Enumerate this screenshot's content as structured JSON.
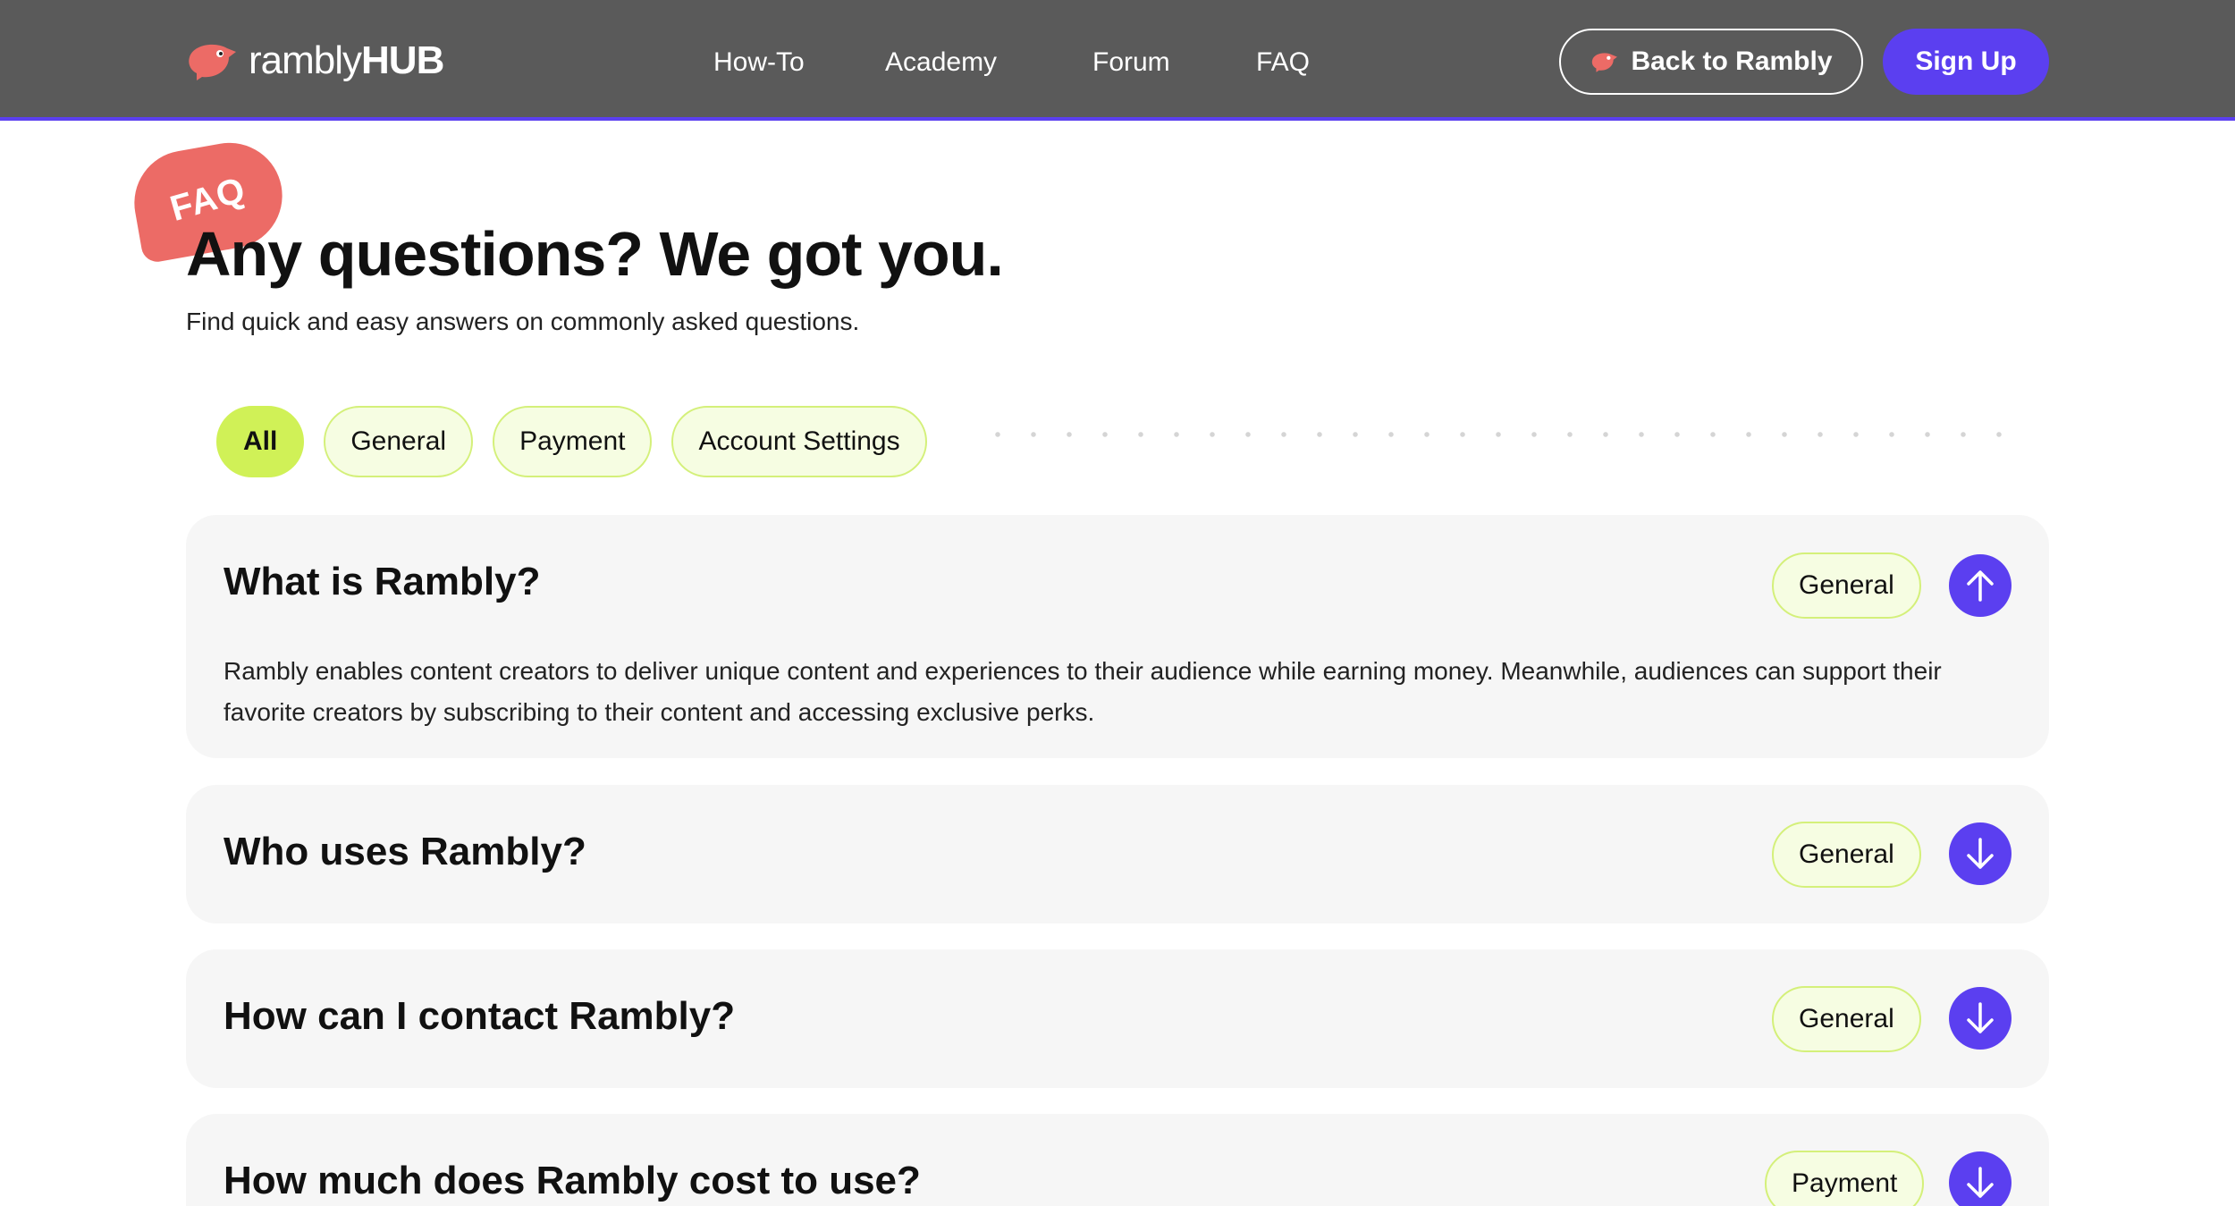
{
  "brand": {
    "logo_primary": "rambly",
    "logo_secondary": "HUB",
    "accent_color": "#5b3ff0",
    "lime_color": "#d0f157",
    "coral_color": "#ec6b66"
  },
  "nav": {
    "items": [
      "How-To",
      "Academy",
      "Forum",
      "FAQ"
    ]
  },
  "header": {
    "back_label": "Back to Rambly",
    "signup_label": "Sign Up"
  },
  "hero": {
    "badge": "FAQ",
    "title": "Any questions? We got you.",
    "subtitle": "Find quick and easy answers on commonly asked questions."
  },
  "filters": {
    "items": [
      "All",
      "General",
      "Payment",
      "Account Settings"
    ],
    "selected": "All"
  },
  "faqs": [
    {
      "question": "What is Rambly?",
      "tag": "General",
      "expanded": true,
      "answer": "Rambly enables content creators to deliver unique content and experiences to their audience while earning money. Meanwhile, audiences can support their favorite creators by subscribing to their content and accessing exclusive perks."
    },
    {
      "question": "Who uses Rambly?",
      "tag": "General",
      "expanded": false
    },
    {
      "question": "How can I contact Rambly?",
      "tag": "General",
      "expanded": false
    },
    {
      "question": "How much does Rambly cost to use?",
      "tag": "Payment",
      "expanded": false
    }
  ],
  "icons": {
    "collapse": "arrow-up-icon",
    "expand": "arrow-down-icon",
    "logo": "rambly-bird-icon"
  }
}
